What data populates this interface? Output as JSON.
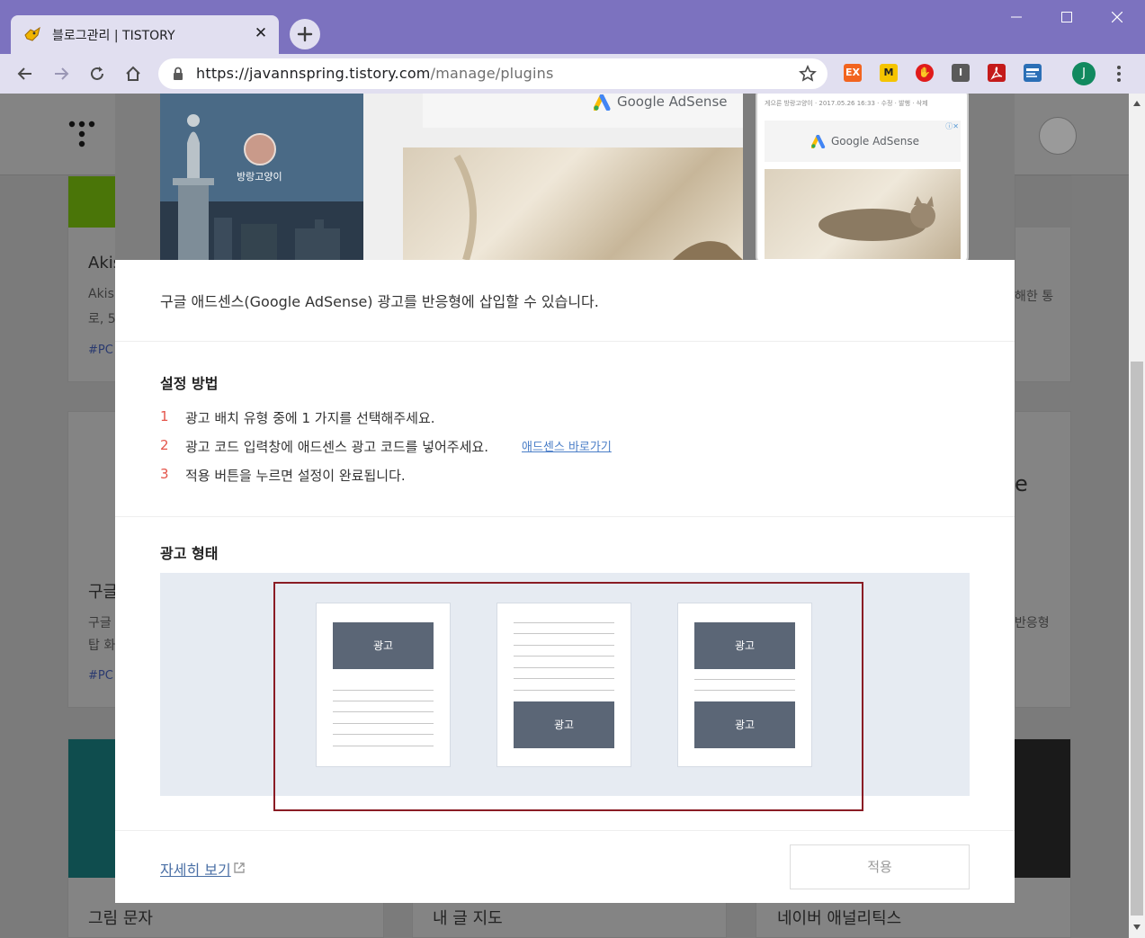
{
  "browser": {
    "tab": {
      "title": "블로그관리 | TISTORY",
      "close": "✕"
    },
    "newtab": "+",
    "url": {
      "scheme": "https://",
      "host": "javannspring.tistory.com",
      "path": "/manage/plugins"
    },
    "extensions": [
      {
        "label": "EX",
        "color": "#f2641f"
      },
      {
        "label": "M",
        "color": "#f5c400"
      },
      {
        "label": "✋",
        "color": "#e01b1b"
      },
      {
        "label": "I",
        "color": "#5a5a5a"
      },
      {
        "label": "",
        "color": "#c41a1a"
      },
      {
        "label": "",
        "color": "#2b6fb6"
      }
    ],
    "profile_initial": "J"
  },
  "background_page": {
    "cards": [
      {
        "title": "Akis",
        "desc1": "Akis",
        "desc2": "로, 5",
        "tag": "#PC"
      },
      {
        "title": "구글",
        "desc1": "구글",
        "desc2": "탑 화",
        "tag": "#PC"
      }
    ],
    "right_snippets": [
      "해한 통",
      "반응형",
      "e"
    ],
    "bottom_labels": [
      "그림 문자",
      "내 글 지도",
      "네이버 애널리틱스"
    ]
  },
  "modal": {
    "preview": {
      "nickname": "방랑고양이",
      "adsense_label": "Google AdSense",
      "phone_meta": "게으른 방랑고양이 · 2017.05.26 16:33 · 수정 · 발행 · 삭제",
      "phone_ad_close": "ⓘ✕"
    },
    "description": "구글 애드센스(Google AdSense) 광고를 반응형에 삽입할 수 있습니다.",
    "setup": {
      "title": "설정 방법",
      "steps": [
        {
          "num": "1",
          "text": "광고 배치 유형 중에 1 가지를 선택해주세요."
        },
        {
          "num": "2",
          "text": "광고 코드 입력창에 애드센스 광고 코드를 넣어주세요."
        },
        {
          "num": "3",
          "text": "적용 버튼을 누르면 설정이 완료됩니다."
        }
      ],
      "link": "애드센스 바로가기"
    },
    "ad_type": {
      "title": "광고 형태",
      "ad_label": "광고"
    },
    "footer": {
      "more_link": "자세히 보기",
      "apply": "적용"
    }
  }
}
